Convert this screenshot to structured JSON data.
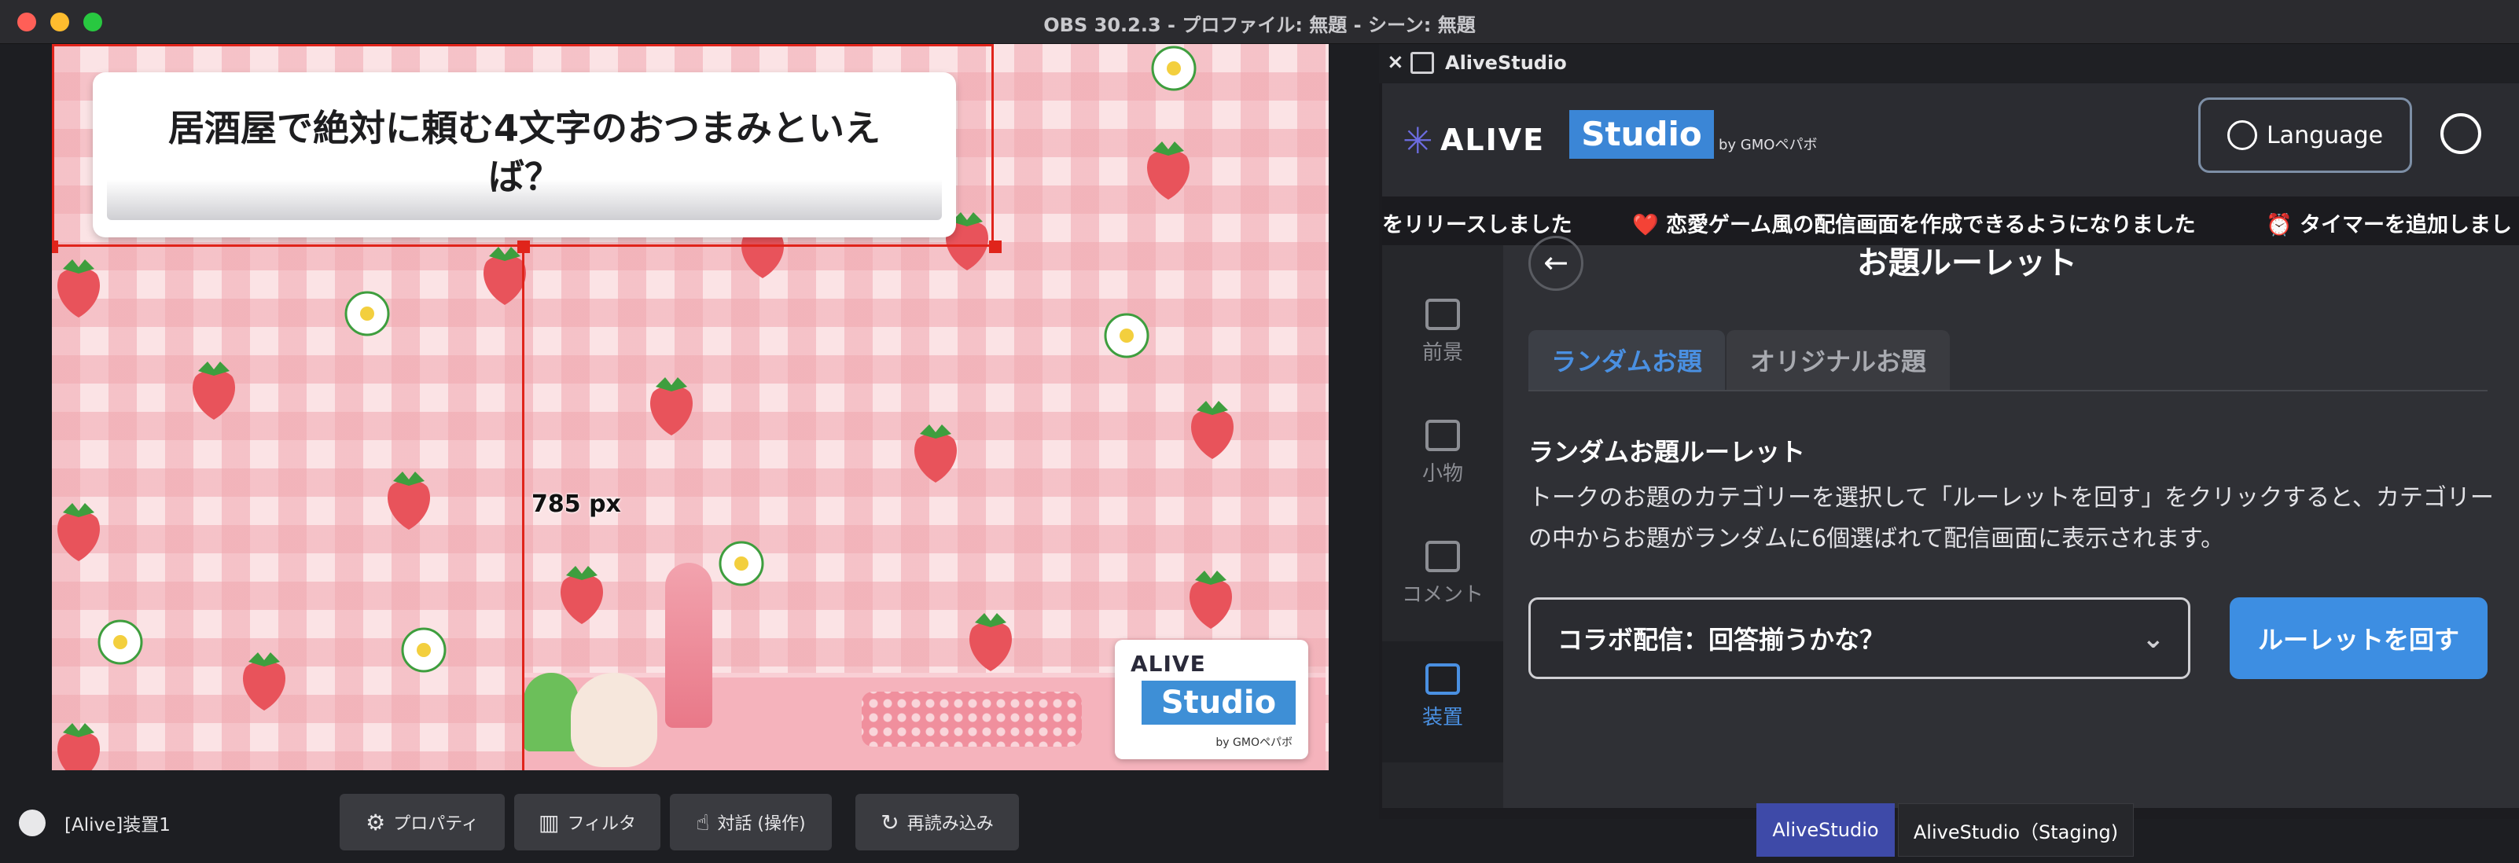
{
  "window": {
    "title": "OBS 30.2.3 - プロファイル: 無題 - シーン: 無題"
  },
  "preview": {
    "question_text": "居酒屋で絶対に頼む4文字のおつまみといえば？",
    "measure_label": "785 px",
    "logo": {
      "alive": "ALIVE",
      "studio": "Studio",
      "by": "by GMOペパボ"
    }
  },
  "source_bar": {
    "source_name": "[Alive]装置1",
    "buttons": {
      "properties": "プロパティ",
      "filters": "フィルタ",
      "interact": "対話 (操作)",
      "reload": "再読み込み"
    }
  },
  "dock": {
    "title": "AliveStudio",
    "close": "×",
    "brand": {
      "alive": "ALIVE",
      "studio": "Studio",
      "by": "by GMOペパボ"
    },
    "language_button": "Language",
    "ticker": [
      "をリリースしました",
      "❤️ 恋愛ゲーム風の配信画面を作成できるようになりました",
      "⏰ タイマーを追加しまし"
    ],
    "sidebar": [
      {
        "label": "前景",
        "icon": "image-add-icon"
      },
      {
        "label": "小物",
        "icon": "cup-icon"
      },
      {
        "label": "コメント",
        "icon": "comment-icon"
      },
      {
        "label": "装置",
        "icon": "grid-icon",
        "active": true
      }
    ],
    "section_title": "お題ルーレット",
    "tabs": {
      "random": "ランダムお題",
      "original": "オリジナルお題"
    },
    "subtitle": "ランダムお題ルーレット",
    "description": "トークのお題のカテゴリーを選択して「ルーレットを回す」をクリックすると、カテゴリーの中からお題がランダムに6個選ばれて配信画面に表示されます。",
    "category_select_value": "コラボ配信：回答揃うかな？",
    "spin_button": "ルーレットを回す",
    "bottom_tabs": {
      "alive": "AliveStudio",
      "staging": "AliveStudio（Staging)"
    }
  },
  "colors": {
    "accent_blue": "#3d8ee2",
    "tab_active_blue": "#4a90e2",
    "selection_red": "#e0241b",
    "dock_tab_active": "#3e4aa8"
  }
}
